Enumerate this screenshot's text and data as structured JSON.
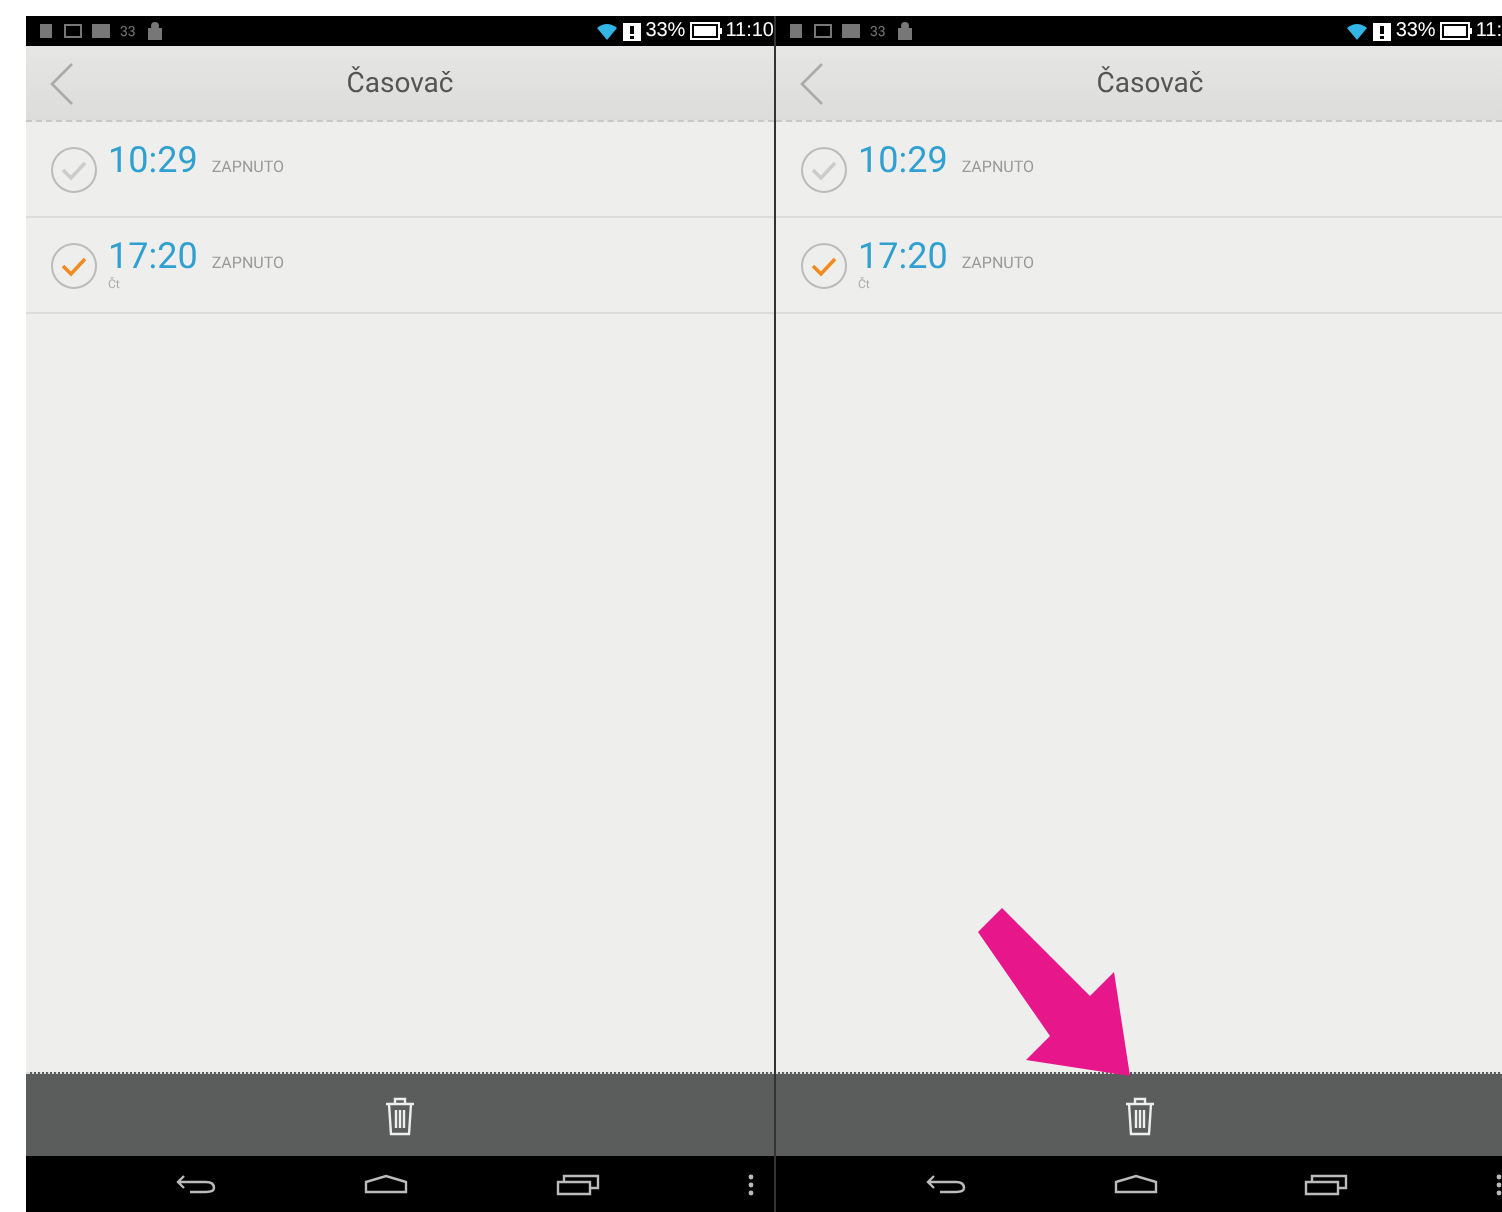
{
  "panels": [
    {
      "status_bar": {
        "notification_count": "33",
        "battery": "33%",
        "time": "11:10"
      },
      "title": "Časovač",
      "alarms": [
        {
          "time": "10:29",
          "state": "ZAPNUTO",
          "on": false
        },
        {
          "time": "17:20",
          "state": "ZAPNUTO",
          "days": "Čt",
          "on": true
        }
      ]
    },
    {
      "status_bar": {
        "notification_count": "33",
        "battery": "33%",
        "time": "11:"
      },
      "title": "Časovač",
      "annotation": {
        "kind": "arrow"
      },
      "alarms": [
        {
          "time": "10:29",
          "state": "ZAPNUTO",
          "on": false
        },
        {
          "time": "17:20",
          "state": "ZAPNUTO",
          "days": "Čt",
          "on": true
        }
      ]
    }
  ]
}
